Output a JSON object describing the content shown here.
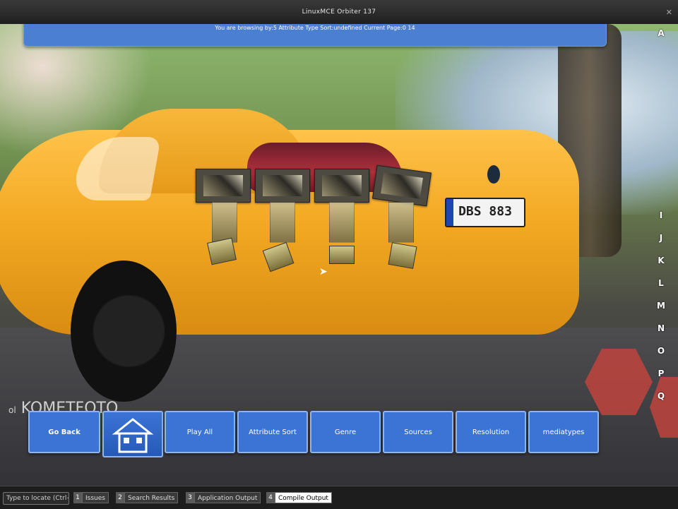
{
  "window": {
    "title": "LinuxMCE Orbiter 137",
    "close_glyph": "✕"
  },
  "banner": {
    "text": "You are browsing by:5   Attribute Type Sort:undefined   Current Page:0   14"
  },
  "watermark": {
    "prefix": "ol",
    "brand": "KOMETFOTO"
  },
  "car": {
    "plate": "DBS 883"
  },
  "alphabet": [
    "A",
    "I",
    "J",
    "K",
    "L",
    "M",
    "N",
    "O",
    "P",
    "Q"
  ],
  "toolbar": {
    "go_back": "Go Back",
    "play_all": "Play All",
    "attribute_sort": "Attribute Sort",
    "genre": "Genre",
    "sources": "Sources",
    "resolution": "Resolution",
    "mediatypes": "mediatypes"
  },
  "statusbar": {
    "locator": "Type to locate (Ctrl+K)",
    "tabs": [
      {
        "num": "1",
        "label": "Issues"
      },
      {
        "num": "2",
        "label": "Search Results"
      },
      {
        "num": "3",
        "label": "Application Output"
      },
      {
        "num": "4",
        "label": "Compile Output"
      }
    ]
  },
  "colors": {
    "accent": "#3c74d6",
    "accent_border": "#8fb4f0",
    "banner": "#4a7fd1"
  }
}
